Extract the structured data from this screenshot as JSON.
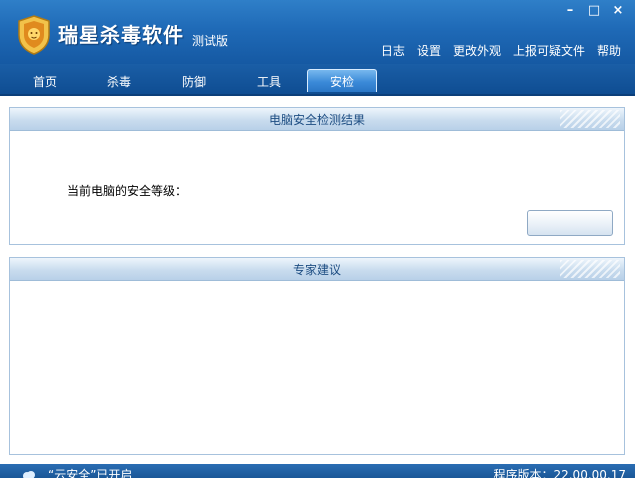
{
  "app": {
    "name": "瑞星杀毒软件",
    "edition": "测试版"
  },
  "window_controls": {
    "minimize": "–",
    "maximize": "□",
    "close": "×"
  },
  "top_menu": [
    "日志",
    "设置",
    "更改外观",
    "上报可疑文件",
    "帮助"
  ],
  "tabs": [
    {
      "label": "首页",
      "active": false
    },
    {
      "label": "杀毒",
      "active": false
    },
    {
      "label": "防御",
      "active": false
    },
    {
      "label": "工具",
      "active": false
    },
    {
      "label": "安检",
      "active": true
    }
  ],
  "security_panel": {
    "title": "电脑安全检测结果",
    "level_label": "当前电脑的安全等级："
  },
  "advice_panel": {
    "title": "专家建议"
  },
  "status": {
    "cloud_text": "“云安全”已开启",
    "version_text": "程序版本：22.00.00.17"
  },
  "colors": {
    "titlebar": "#1f6ab7",
    "tabbar": "#0f4d92",
    "panel_border": "#a7c2dd",
    "panel_title": "#1d4d82"
  },
  "icons": {
    "logo": "lion-shield-logo",
    "status": "cloud-icon"
  }
}
